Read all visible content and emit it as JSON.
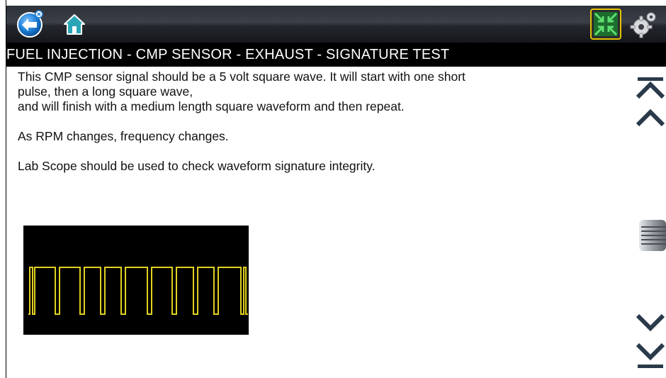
{
  "toolbar": {
    "back_icon": "back-arrow-icon",
    "home_icon": "home-icon",
    "fullscreen_icon": "collapse-arrows-icon",
    "settings_icon": "gear-settings-icon",
    "accent": "#e6c200"
  },
  "title": "FUEL INJECTION - CMP SENSOR - EXHAUST - SIGNATURE TEST",
  "body": {
    "line1": "This CMP sensor signal should be a 5 volt square wave. It will start with one short",
    "line2": "pulse, then a long square wave,",
    "line3": "and will finish with a medium length square waveform and then repeat.",
    "line4": "As RPM changes, frequency changes.",
    "line5": "Lab Scope should be used to check waveform signature integrity."
  },
  "scope": {
    "trace_color": "#e0d020",
    "background": "#000000"
  },
  "scrollbar": {
    "top_icon": "scroll-to-top-icon",
    "up_icon": "scroll-up-icon",
    "thumb_icon": "scroll-thumb-icon",
    "down_icon": "scroll-down-icon",
    "bottom_icon": "scroll-to-bottom-icon"
  }
}
